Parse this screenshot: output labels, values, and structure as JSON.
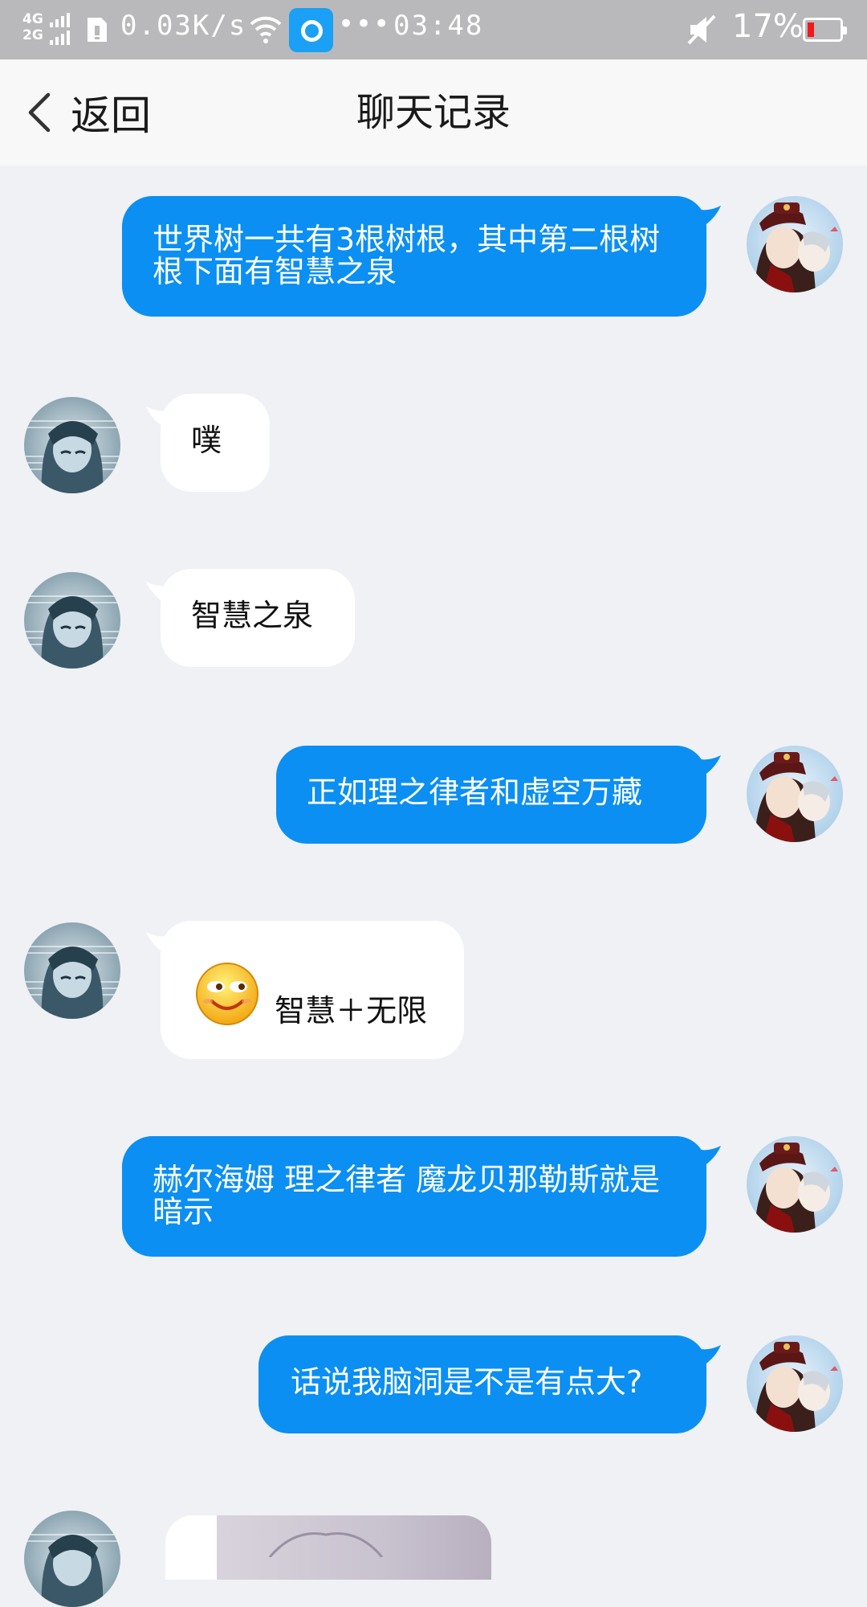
{
  "status_bar": {
    "net_4g": "4G",
    "net_2g": "2G",
    "speed": "0.03K/s",
    "dots": "•••",
    "time": "03:48",
    "battery_pct": "17%",
    "battery_level": 0.17,
    "colors": {
      "battery_low": "#f01a1a",
      "app_icon": "#1aa0f5"
    }
  },
  "header": {
    "back_label": "返回",
    "title": "聊天记录"
  },
  "messages": [
    {
      "side": "self",
      "text": "世界树一共有3根树根，其中第二根树根下面有智慧之泉"
    },
    {
      "side": "other",
      "text": "噗"
    },
    {
      "side": "other",
      "text": "智慧之泉"
    },
    {
      "side": "self",
      "text": "正如理之律者和虚空万藏"
    },
    {
      "side": "other",
      "emoji": "smile-emoji",
      "text": "智慧＋无限"
    },
    {
      "side": "self",
      "text": "赫尔海姆  理之律者  魔龙贝那勒斯就是暗示"
    },
    {
      "side": "self",
      "text": "话说我脑洞是不是有点大?"
    }
  ],
  "colors": {
    "outgoing_bubble": "#0b8ff2",
    "incoming_bubble": "#ffffff",
    "chat_background": "#eff1f4",
    "header_background": "#f8f8f9",
    "status_bar_background": "#b9b9bb"
  }
}
